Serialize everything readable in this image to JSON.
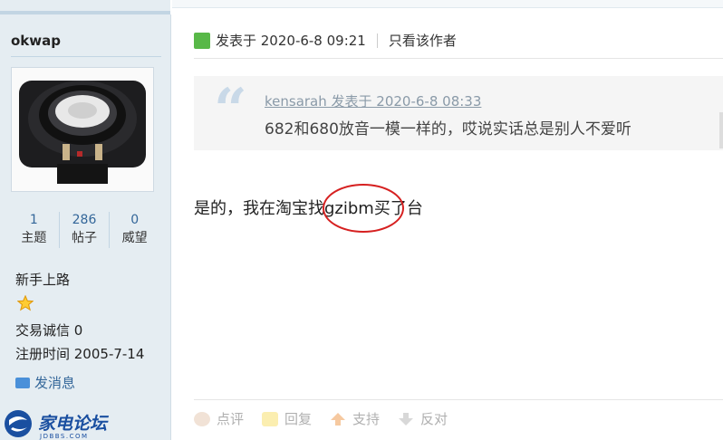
{
  "author": {
    "username": "okwap",
    "stats": [
      {
        "value": "1",
        "label": "主题"
      },
      {
        "value": "286",
        "label": "帖子"
      },
      {
        "value": "0",
        "label": "威望"
      }
    ],
    "rank": "新手上路",
    "trade_credit": "交易诚信  0",
    "register_time": "注册时间  2005-7-14",
    "send_message": "发消息"
  },
  "logo": {
    "text": "家电论坛",
    "subtext": "JDBBS.COM"
  },
  "post": {
    "posted_at": "发表于 2020-6-8 09:21",
    "only_author": "只看该作者",
    "quote": {
      "source": "kensarah 发表于 2020-6-8 08:33",
      "text": "682和680放音一模一样的，哎说实话总是别人不爱听"
    },
    "content": "是的，我在淘宝找gzibm买了台"
  },
  "actions": [
    {
      "label": "点评",
      "icon": "comment-icon"
    },
    {
      "label": "回复",
      "icon": "reply-icon"
    },
    {
      "label": "支持",
      "icon": "thumb-up-icon"
    },
    {
      "label": "反对",
      "icon": "thumb-down-icon"
    }
  ],
  "colors": {
    "sidebar_bg": "#e5edf2",
    "link": "#336699",
    "highlight_circle": "#d62020"
  }
}
